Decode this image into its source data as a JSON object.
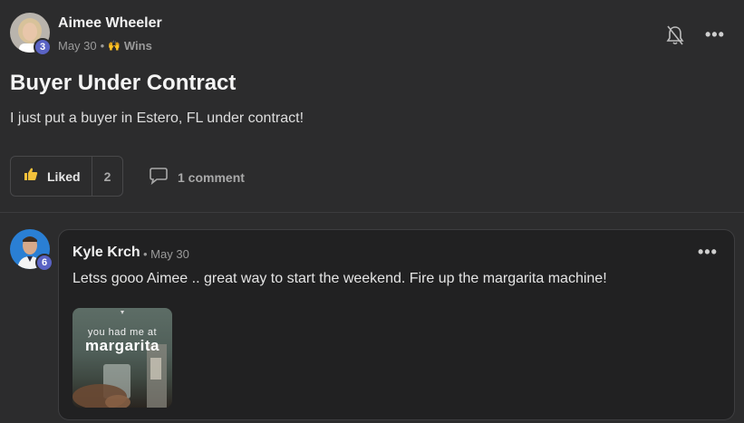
{
  "post": {
    "author": "Aimee Wheeler",
    "author_level": "3",
    "date": "May 30",
    "category": "Wins",
    "title": "Buyer Under Contract",
    "body": "I just put a buyer in Estero, FL under contract!",
    "like_label": "Liked",
    "like_count": "2",
    "comment_label": "1 comment"
  },
  "comment": {
    "author": "Kyle Krch",
    "author_level": "6",
    "meta": "• May 30",
    "text": "Letss gooo Aimee .. great way to start the weekend. Fire up the margarita machine!",
    "gif_line1": "you had me at",
    "gif_line2": "margarita"
  },
  "icons": {
    "bell": "bell-muted-icon",
    "more": "more-horizontal-icon",
    "like": "thumbs-up-icon",
    "comment": "speech-bubble-icon",
    "category": "raised-hands-emoji"
  },
  "colors": {
    "background": "#2c2c2d",
    "card": "#212122",
    "level_badge": "#5a63c4",
    "like_icon": "#f2c13b"
  }
}
